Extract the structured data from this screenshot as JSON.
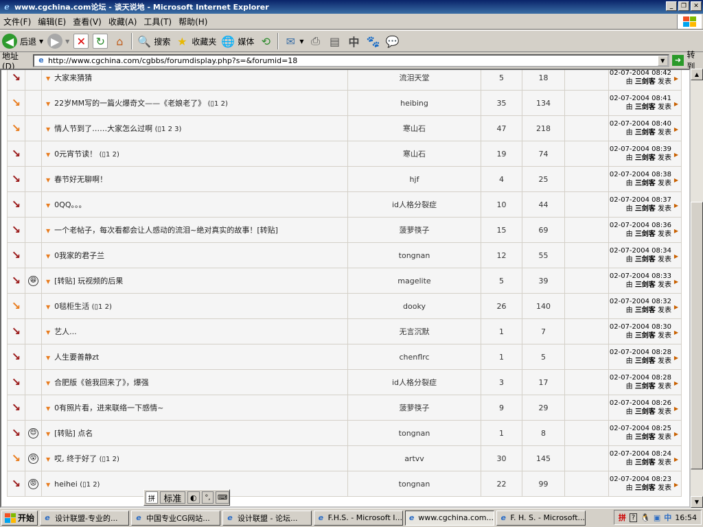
{
  "window": {
    "title": "www.cgchina.com论坛 - 谈天说地 - Microsoft Internet Explorer"
  },
  "menu": [
    "文件(F)",
    "编辑(E)",
    "查看(V)",
    "收藏(A)",
    "工具(T)",
    "帮助(H)"
  ],
  "toolbar": {
    "back": "后退",
    "search": "搜索",
    "favorites": "收藏夹",
    "media": "媒体"
  },
  "address": {
    "label": "地址(D)",
    "url": "http://www.cgchina.com/cgbbs/forumdisplay.php?s=&forumid=18",
    "go": "转到"
  },
  "threads": [
    {
      "hot": false,
      "emoticon": "",
      "title": "大家来猜猜",
      "pages": "",
      "author": "流泪天堂",
      "replies": "5",
      "views": "18",
      "date": "02-07-2004 08:42",
      "last_by": "三剑客",
      "post_label": "发表"
    },
    {
      "hot": true,
      "emoticon": "",
      "title": "22岁MM写的一篇火爆奇文——《老娘老了》",
      "pages": "1 2",
      "author": "heibing",
      "replies": "35",
      "views": "134",
      "date": "02-07-2004 08:41",
      "last_by": "三剑客",
      "post_label": "发表"
    },
    {
      "hot": true,
      "emoticon": "",
      "title": "情人节到了……大家怎么过啊",
      "pages": "1 2 3",
      "author": "寒山石",
      "replies": "47",
      "views": "218",
      "date": "02-07-2004 08:40",
      "last_by": "三剑客",
      "post_label": "发表"
    },
    {
      "hot": false,
      "emoticon": "",
      "title": "0元宵节读！",
      "pages": "1 2",
      "author": "寒山石",
      "replies": "19",
      "views": "74",
      "date": "02-07-2004 08:39",
      "last_by": "三剑客",
      "post_label": "发表"
    },
    {
      "hot": false,
      "emoticon": "",
      "title": "春节好无聊啊！",
      "pages": "",
      "author": "hjf",
      "replies": "4",
      "views": "25",
      "date": "02-07-2004 08:38",
      "last_by": "三剑客",
      "post_label": "发表"
    },
    {
      "hot": false,
      "emoticon": "",
      "title": "0QQ。。。",
      "pages": "",
      "author": "id人格分裂症",
      "replies": "10",
      "views": "44",
      "date": "02-07-2004 08:37",
      "last_by": "三剑客",
      "post_label": "发表"
    },
    {
      "hot": false,
      "emoticon": "",
      "title": "一个老帖子，每次看都会让人感动的流泪~绝对真实的故事！[转贴]",
      "pages": "",
      "author": "菠萝筷子",
      "replies": "15",
      "views": "69",
      "date": "02-07-2004 08:36",
      "last_by": "三剑客",
      "post_label": "发表"
    },
    {
      "hot": false,
      "emoticon": "",
      "title": "0我家的君子兰",
      "pages": "",
      "author": "tongnan",
      "replies": "12",
      "views": "55",
      "date": "02-07-2004 08:34",
      "last_by": "三剑客",
      "post_label": "发表"
    },
    {
      "hot": false,
      "emoticon": "😆",
      "title": "[转贴] 玩视频的后果",
      "pages": "",
      "author": "magelite",
      "replies": "5",
      "views": "39",
      "date": "02-07-2004 08:33",
      "last_by": "三剑客",
      "post_label": "发表"
    },
    {
      "hot": true,
      "emoticon": "",
      "title": "0毯柜生活",
      "pages": "1 2",
      "author": "dooky",
      "replies": "26",
      "views": "140",
      "date": "02-07-2004 08:32",
      "last_by": "三剑客",
      "post_label": "发表"
    },
    {
      "hot": false,
      "emoticon": "",
      "title": "艺人...",
      "pages": "",
      "author": "无言沉默",
      "replies": "1",
      "views": "7",
      "date": "02-07-2004 08:30",
      "last_by": "三剑客",
      "post_label": "发表"
    },
    {
      "hot": false,
      "emoticon": "",
      "title": "人生要善静zt",
      "pages": "",
      "author": "chenflrc",
      "replies": "1",
      "views": "5",
      "date": "02-07-2004 08:28",
      "last_by": "三剑客",
      "post_label": "发表"
    },
    {
      "hot": false,
      "emoticon": "",
      "title": "合肥版《爸我回来了》，爆强",
      "pages": "",
      "author": "id人格分裂症",
      "replies": "3",
      "views": "17",
      "date": "02-07-2004 08:28",
      "last_by": "三剑客",
      "post_label": "发表"
    },
    {
      "hot": false,
      "emoticon": "",
      "title": "0有照片看，进来联络一下感情~",
      "pages": "",
      "author": "菠萝筷子",
      "replies": "9",
      "views": "29",
      "date": "02-07-2004 08:26",
      "last_by": "三剑客",
      "post_label": "发表"
    },
    {
      "hot": false,
      "emoticon": "😊",
      "title": "[转贴] 点名",
      "pages": "",
      "author": "tongnan",
      "replies": "1",
      "views": "8",
      "date": "02-07-2004 08:25",
      "last_by": "三剑客",
      "post_label": "发表"
    },
    {
      "hot": true,
      "emoticon": "😮",
      "title": "哎, 终于好了",
      "pages": "1 2",
      "author": "artvv",
      "replies": "30",
      "views": "145",
      "date": "02-07-2004 08:24",
      "last_by": "三剑客",
      "post_label": "发表"
    },
    {
      "hot": false,
      "emoticon": "😡",
      "title": "heihei",
      "pages": "1 2",
      "author": "tongnan",
      "replies": "22",
      "views": "99",
      "date": "02-07-2004 08:23",
      "last_by": "三剑客",
      "post_label": "发表"
    }
  ],
  "ime": {
    "mode": "标准"
  },
  "taskbar": {
    "start": "开始",
    "tasks": [
      "设计联盟-专业的...",
      "中国专业CG网站...",
      "设计联盟 - 论坛...",
      "F.H.S. - Microsoft I...",
      "www.cgchina.com...",
      "F. H. S. - Microsoft..."
    ],
    "clock": "16:54"
  }
}
